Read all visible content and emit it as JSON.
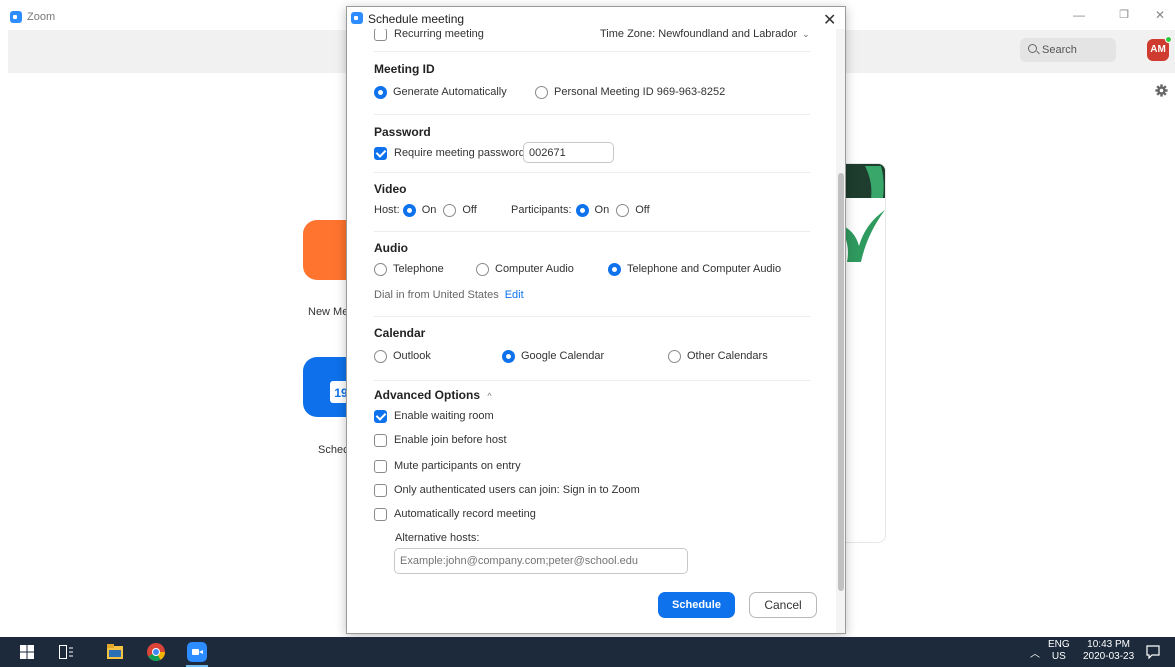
{
  "app": {
    "title": "Zoom",
    "search_placeholder": "Search",
    "avatar_initials": "AM",
    "home_labels": {
      "new_meeting": "New Me",
      "schedule": "Schec"
    },
    "calendar_day": "19"
  },
  "dialog": {
    "title": "Schedule meeting",
    "close_glyph": "✕",
    "recurring_label": "Recurring meeting",
    "timezone_label": "Time Zone: Newfoundland and Labrador",
    "meeting_id": {
      "title": "Meeting ID",
      "options": [
        {
          "label": "Generate Automatically",
          "selected": true
        },
        {
          "label": "Personal Meeting ID 969-963-8252",
          "selected": false
        }
      ]
    },
    "password": {
      "title": "Password",
      "require_label": "Require meeting password",
      "require_checked": true,
      "value": "002671"
    },
    "video": {
      "title": "Video",
      "host_label": "Host:",
      "participants_label": "Participants:",
      "on_label": "On",
      "off_label": "Off",
      "host_on": true,
      "participants_on": true
    },
    "audio": {
      "title": "Audio",
      "options": [
        {
          "label": "Telephone",
          "selected": false
        },
        {
          "label": "Computer Audio",
          "selected": false
        },
        {
          "label": "Telephone and Computer Audio",
          "selected": true
        }
      ],
      "dial_in_text": "Dial in from United States",
      "edit_link": "Edit"
    },
    "calendar": {
      "title": "Calendar",
      "options": [
        {
          "label": "Outlook",
          "selected": false
        },
        {
          "label": "Google Calendar",
          "selected": true
        },
        {
          "label": "Other Calendars",
          "selected": false
        }
      ]
    },
    "advanced": {
      "title": "Advanced Options",
      "options": [
        {
          "label": "Enable waiting room",
          "checked": true
        },
        {
          "label": "Enable join before host",
          "checked": false
        },
        {
          "label": "Mute participants on entry",
          "checked": false
        },
        {
          "label": "Only authenticated users can join: Sign in to Zoom",
          "checked": false
        },
        {
          "label": "Automatically record meeting",
          "checked": false
        }
      ],
      "alt_hosts_label": "Alternative hosts:",
      "alt_hosts_placeholder": "Example:john@company.com;peter@school.edu"
    },
    "schedule_button": "Schedule",
    "cancel_button": "Cancel"
  },
  "taskbar": {
    "lang_top": "ENG",
    "lang_bottom": "US",
    "time": "10:43 PM",
    "date": "2020-03-23"
  },
  "colors": {
    "accent": "#0e72ed",
    "zoom_blue": "#2D8CFF",
    "new_meeting_orange": "#FF742E",
    "taskbar": "#1c2a3b"
  }
}
